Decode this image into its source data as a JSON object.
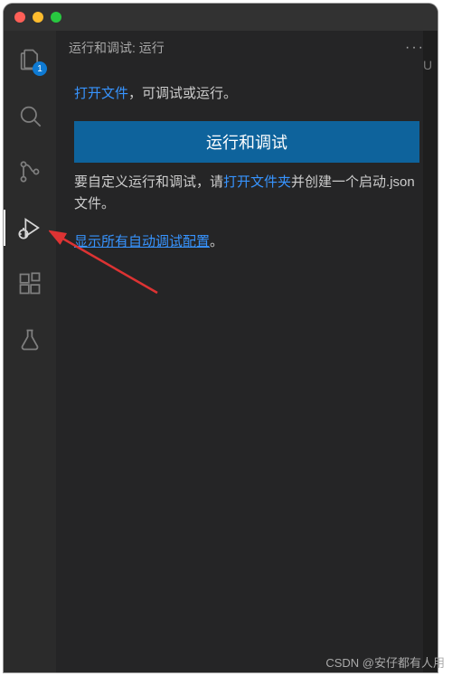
{
  "window": {
    "explorer_badge": "1"
  },
  "sidebar": {
    "title": "运行和调试: 运行",
    "more": "···",
    "open_file_link": "打开文件",
    "open_file_suffix": "，可调试或运行。",
    "run_button": "运行和调试",
    "custom_prefix": "要自定义运行和调试，请",
    "open_folder_link": "打开文件夹",
    "custom_suffix": "并创建一个启动.json 文件。",
    "show_all_link": "显示所有自动调试配置",
    "show_all_suffix": "。"
  },
  "right_hint": "U",
  "watermark": "CSDN @安仔都有人用"
}
